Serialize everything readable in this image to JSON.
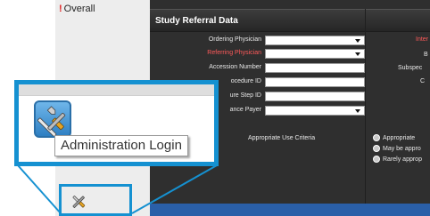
{
  "sidebar": {
    "overall_marker": "!",
    "overall_label": "Overall"
  },
  "main": {
    "title": "Study Referral Data",
    "fields": [
      {
        "label": "Ordering Physician",
        "type": "select",
        "required": false
      },
      {
        "label": "Referring Physician",
        "type": "select",
        "required": true
      },
      {
        "label": "Accession Number",
        "type": "text",
        "required": false
      },
      {
        "label": "ocedure ID",
        "type": "text",
        "required": false
      },
      {
        "label": "ure Step ID",
        "type": "text",
        "required": false
      },
      {
        "label": "ance Payer",
        "type": "select",
        "required": false
      }
    ],
    "right_labels": [
      {
        "text": "Inter",
        "required": true
      },
      {
        "text": "B",
        "required": false
      },
      {
        "text": "Subspec",
        "required": false
      },
      {
        "text": "C",
        "required": false
      }
    ],
    "auc": {
      "label": "Appropriate Use Criteria",
      "options": [
        "Appropriate",
        "May be appro",
        "Rarely approp"
      ]
    }
  },
  "zoom": {
    "tooltip": "Administration Login",
    "icon": "wrench-screwdriver-icon"
  },
  "colors": {
    "accent": "#1591d1",
    "required": "#ff5a5a",
    "panel_dark": "#2f2f2f"
  }
}
